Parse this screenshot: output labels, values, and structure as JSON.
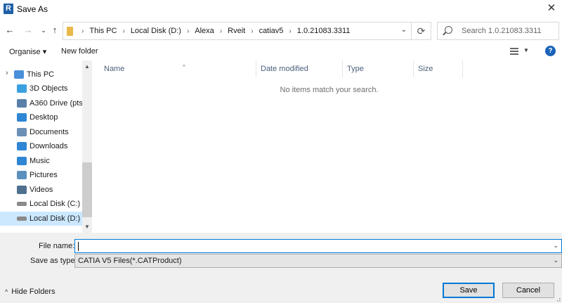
{
  "window": {
    "title": "Save As",
    "app_icon_letter": "R"
  },
  "nav": {
    "back_icon": "arrow-left-icon",
    "forward_icon": "arrow-right-icon",
    "recent_icon": "chevron-down-icon",
    "up_icon": "arrow-up-icon",
    "breadcrumbs": [
      "This PC",
      "Local Disk (D:)",
      "Alexa",
      "Rveit",
      "catiav5",
      "1.0.21083.3311"
    ],
    "search_placeholder": "Search 1.0.21083.3311"
  },
  "toolbar": {
    "organise_label": "Organise ▾",
    "new_folder_label": "New folder",
    "help_label": "?"
  },
  "sidebar": {
    "items": [
      {
        "label": "This PC",
        "icon": "computer-icon"
      },
      {
        "label": "3D Objects",
        "icon": "cube-icon"
      },
      {
        "label": "A360 Drive (pts.u",
        "icon": "cloud-drive-icon"
      },
      {
        "label": "Desktop",
        "icon": "desktop-icon"
      },
      {
        "label": "Documents",
        "icon": "documents-icon"
      },
      {
        "label": "Downloads",
        "icon": "download-icon"
      },
      {
        "label": "Music",
        "icon": "music-icon"
      },
      {
        "label": "Pictures",
        "icon": "pictures-icon"
      },
      {
        "label": "Videos",
        "icon": "videos-icon"
      },
      {
        "label": "Local Disk (C:)",
        "icon": "drive-icon"
      },
      {
        "label": "Local Disk (D:)",
        "icon": "drive-icon"
      }
    ]
  },
  "columns": {
    "name": "Name",
    "date_modified": "Date modified",
    "type": "Type",
    "size": "Size"
  },
  "list": {
    "empty_message": "No items match your search."
  },
  "form": {
    "file_name_label": "File name:",
    "file_name_value": "",
    "save_as_type_label": "Save as type:",
    "save_as_type_value": "CATIA V5 Files(*.CATProduct)"
  },
  "footer": {
    "hide_folders_label": "Hide Folders",
    "save_label": "Save",
    "cancel_label": "Cancel"
  },
  "colors": {
    "accent": "#0078d7",
    "selected_bg": "#cce8ff",
    "header_text": "#4c607a"
  }
}
